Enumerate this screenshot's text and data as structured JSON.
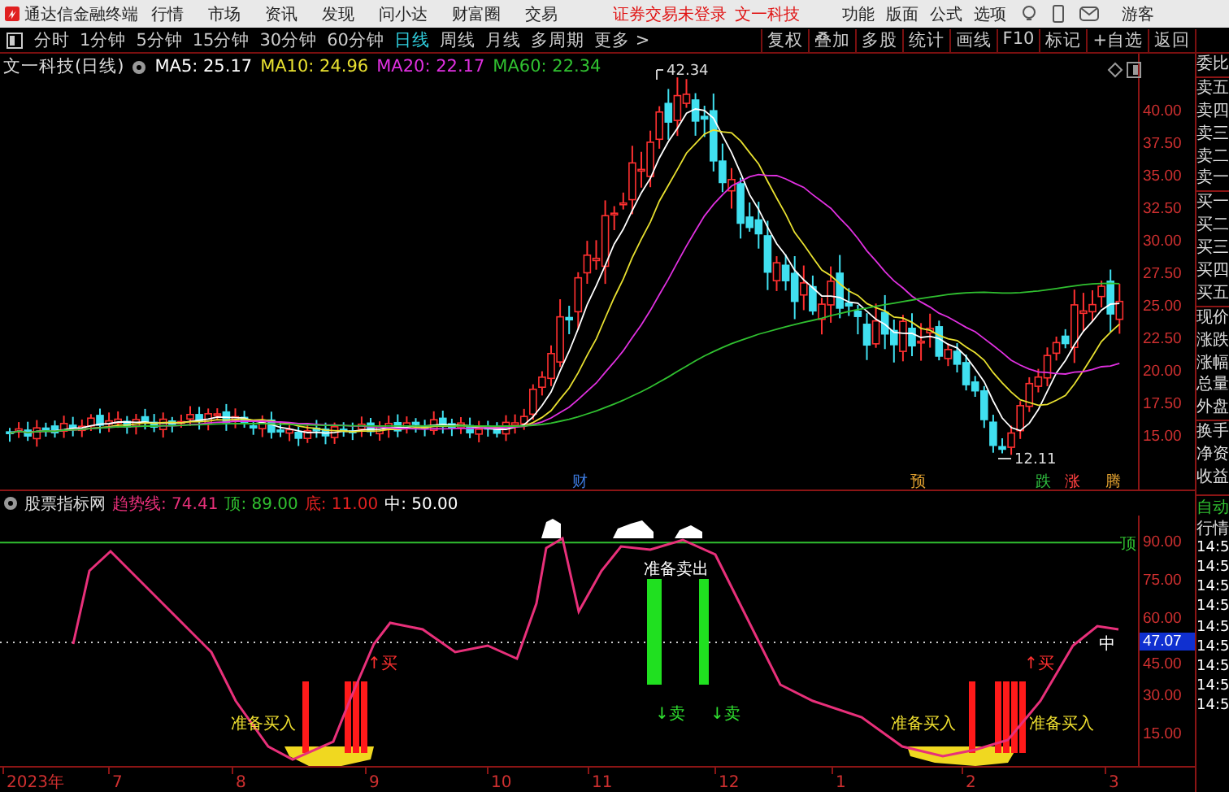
{
  "app": {
    "title": "通达信金融终端",
    "menu": [
      "行情",
      "市场",
      "资讯",
      "发现",
      "问小达",
      "财富圈",
      "交易"
    ],
    "login_status": "证券交易未登录",
    "stock_link": "文一科技",
    "right_menu": [
      "功能",
      "版面",
      "公式",
      "选项"
    ],
    "user": "游客"
  },
  "periods": [
    {
      "label": "分时",
      "selected": false
    },
    {
      "label": "1分钟",
      "selected": false
    },
    {
      "label": "5分钟",
      "selected": false
    },
    {
      "label": "15分钟",
      "selected": false
    },
    {
      "label": "30分钟",
      "selected": false
    },
    {
      "label": "60分钟",
      "selected": false
    },
    {
      "label": "日线",
      "selected": true
    },
    {
      "label": "周线",
      "selected": false
    },
    {
      "label": "月线",
      "selected": false
    },
    {
      "label": "多周期",
      "selected": false
    },
    {
      "label": "更多 >",
      "selected": false
    }
  ],
  "tools": [
    "复权",
    "叠加",
    "多股",
    "统计",
    "画线",
    "F10",
    "标记",
    "+自选",
    "返回"
  ],
  "price_chart": {
    "title": "文一科技(日线)",
    "ma": [
      {
        "label": "MA5: 25.17",
        "color": "#ffffff"
      },
      {
        "label": "MA10: 24.96",
        "color": "#e8e030"
      },
      {
        "label": "MA20: 22.17",
        "color": "#e030e0"
      },
      {
        "label": "MA60: 22.34",
        "color": "#30c030"
      }
    ],
    "axis": [
      "40.00",
      "37.50",
      "35.00",
      "32.50",
      "30.00",
      "27.50",
      "25.00",
      "22.50",
      "20.00",
      "17.50",
      "15.00"
    ],
    "high_label": "42.34",
    "low_label": "12.11",
    "events": [
      {
        "label": "财",
        "color": "#3d7be0"
      },
      {
        "label": "预",
        "color": "#e0a030"
      },
      {
        "label": "跌",
        "color": "#30c040"
      },
      {
        "label": "涨",
        "color": "#ff4040"
      },
      {
        "label": "腾",
        "color": "#e0a030"
      }
    ]
  },
  "indicator": {
    "name": "股票指标网",
    "readings": [
      {
        "label": "趋势线:",
        "value": "74.41",
        "color": "#e8307a"
      },
      {
        "label": "顶:",
        "value": "89.00",
        "color": "#30c030"
      },
      {
        "label": "底:",
        "value": "11.00",
        "color": "#e02020"
      },
      {
        "label": "中:",
        "value": "50.00",
        "color": "#ffffff"
      }
    ],
    "axis": [
      "90.00",
      "75.00",
      "60.00",
      "45.00",
      "30.00",
      "15.00"
    ],
    "current": "47.07",
    "top_tag": "顶",
    "mid_tag": "中",
    "signals": [
      {
        "kind": "buy_ready",
        "label": "准备买入"
      },
      {
        "kind": "buy",
        "label": "↑买"
      },
      {
        "kind": "sell_ready",
        "label": "准备卖出"
      },
      {
        "kind": "sell",
        "label": "↓卖"
      },
      {
        "kind": "sell",
        "label": "↓卖"
      },
      {
        "kind": "buy_ready",
        "label": "准备买入"
      },
      {
        "kind": "buy",
        "label": "↑买"
      },
      {
        "kind": "buy_ready",
        "label": "准备买入"
      }
    ]
  },
  "quote_panel": {
    "labels": [
      "委比",
      "卖五",
      "卖四",
      "卖三",
      "卖二",
      "卖一",
      "买一",
      "买二",
      "买三",
      "买四",
      "买五",
      "现价",
      "涨跌",
      "涨幅",
      "总量",
      "外盘",
      "换手",
      "净资",
      "收益"
    ],
    "mode": "自动",
    "section": "行情",
    "times": [
      "14:5",
      "14:5",
      "14:5",
      "14:5",
      "14:5",
      "14:5",
      "14:5",
      "14:5",
      "14:5"
    ]
  },
  "time_axis": [
    "2023年",
    "7",
    "8",
    "9",
    "10",
    "11",
    "12",
    "1",
    "2",
    "3"
  ]
}
